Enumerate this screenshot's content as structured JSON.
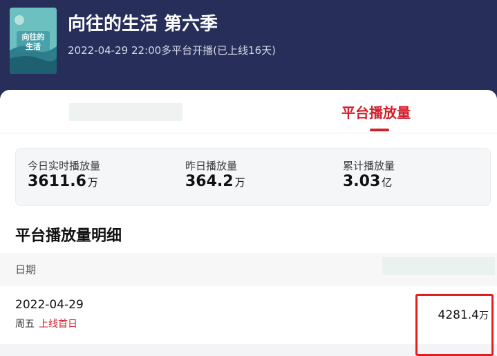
{
  "show": {
    "title": "向往的生活 第六季",
    "subtitle": "2022-04-29 22:00多平台开播(已上线16天)",
    "poster_text": "向往的生活"
  },
  "tabs": {
    "active_label": "平台播放量"
  },
  "stats": [
    {
      "label": "今日实时播放量",
      "value": "3611.6",
      "unit": "万"
    },
    {
      "label": "昨日播放量",
      "value": "364.2",
      "unit": "万"
    },
    {
      "label": "累计播放量",
      "value": "3.03",
      "unit": "亿"
    }
  ],
  "detail": {
    "section_title": "平台播放量明细",
    "date_header": "日期",
    "rows": [
      {
        "date": "2022-04-29",
        "weekday": "周五",
        "tag": "上线首日",
        "value": "4281.4",
        "unit": "万"
      }
    ]
  },
  "colors": {
    "header_bg": "#262e59",
    "accent": "#d21f2b",
    "highlight": "#e02020"
  }
}
